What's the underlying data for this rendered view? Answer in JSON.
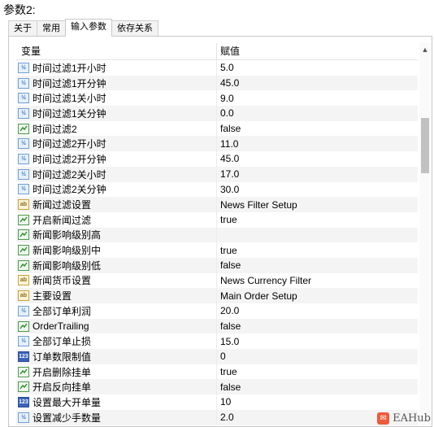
{
  "caption": "参数2:",
  "tabs": [
    {
      "label": "关于",
      "active": false
    },
    {
      "label": "常用",
      "active": false
    },
    {
      "label": "输入参数",
      "active": true
    },
    {
      "label": "依存关系",
      "active": false
    }
  ],
  "columns": {
    "variable": "变量",
    "value": "赋值"
  },
  "params": [
    {
      "icon": "num",
      "name": "时间过滤1开小时",
      "value": "5.0"
    },
    {
      "icon": "num",
      "name": "时间过滤1开分钟",
      "value": "45.0"
    },
    {
      "icon": "num",
      "name": "时间过滤1关小时",
      "value": "9.0"
    },
    {
      "icon": "num",
      "name": "时间过滤1关分钟",
      "value": "0.0"
    },
    {
      "icon": "bool",
      "name": "时间过滤2",
      "value": "false"
    },
    {
      "icon": "num",
      "name": "时间过滤2开小时",
      "value": "11.0"
    },
    {
      "icon": "num",
      "name": "时间过滤2开分钟",
      "value": "45.0"
    },
    {
      "icon": "num",
      "name": "时间过滤2关小时",
      "value": "17.0"
    },
    {
      "icon": "num",
      "name": "时间过滤2关分钟",
      "value": "30.0"
    },
    {
      "icon": "str",
      "name": "新闻过滤设置",
      "value": "News Filter Setup"
    },
    {
      "icon": "bool",
      "name": "开启新闻过滤",
      "value": "true"
    },
    {
      "icon": "bool",
      "name": "新闻影响级别高",
      "value": ""
    },
    {
      "icon": "bool",
      "name": "新闻影响级别中",
      "value": "true"
    },
    {
      "icon": "bool",
      "name": "新闻影响级别低",
      "value": "false"
    },
    {
      "icon": "str",
      "name": "新闻货币设置",
      "value": "News Currency Filter"
    },
    {
      "icon": "str",
      "name": "主要设置",
      "value": "Main Order Setup"
    },
    {
      "icon": "num",
      "name": "全部订单利润",
      "value": "20.0"
    },
    {
      "icon": "bool",
      "name": "OrderTrailing",
      "value": "false"
    },
    {
      "icon": "num",
      "name": "全部订单止损",
      "value": "15.0"
    },
    {
      "icon": "int",
      "name": "订单数限制值",
      "value": "0"
    },
    {
      "icon": "bool",
      "name": "开启删除挂单",
      "value": "true"
    },
    {
      "icon": "bool",
      "name": "开启反向挂单",
      "value": "false"
    },
    {
      "icon": "int",
      "name": "设置最大开单量",
      "value": "10"
    },
    {
      "icon": "num",
      "name": "设置减少手数量",
      "value": "2.0"
    }
  ],
  "icon_glyphs": {
    "num": "½",
    "bool": "",
    "str": "ab",
    "int": "123"
  },
  "watermark": "EAHub"
}
